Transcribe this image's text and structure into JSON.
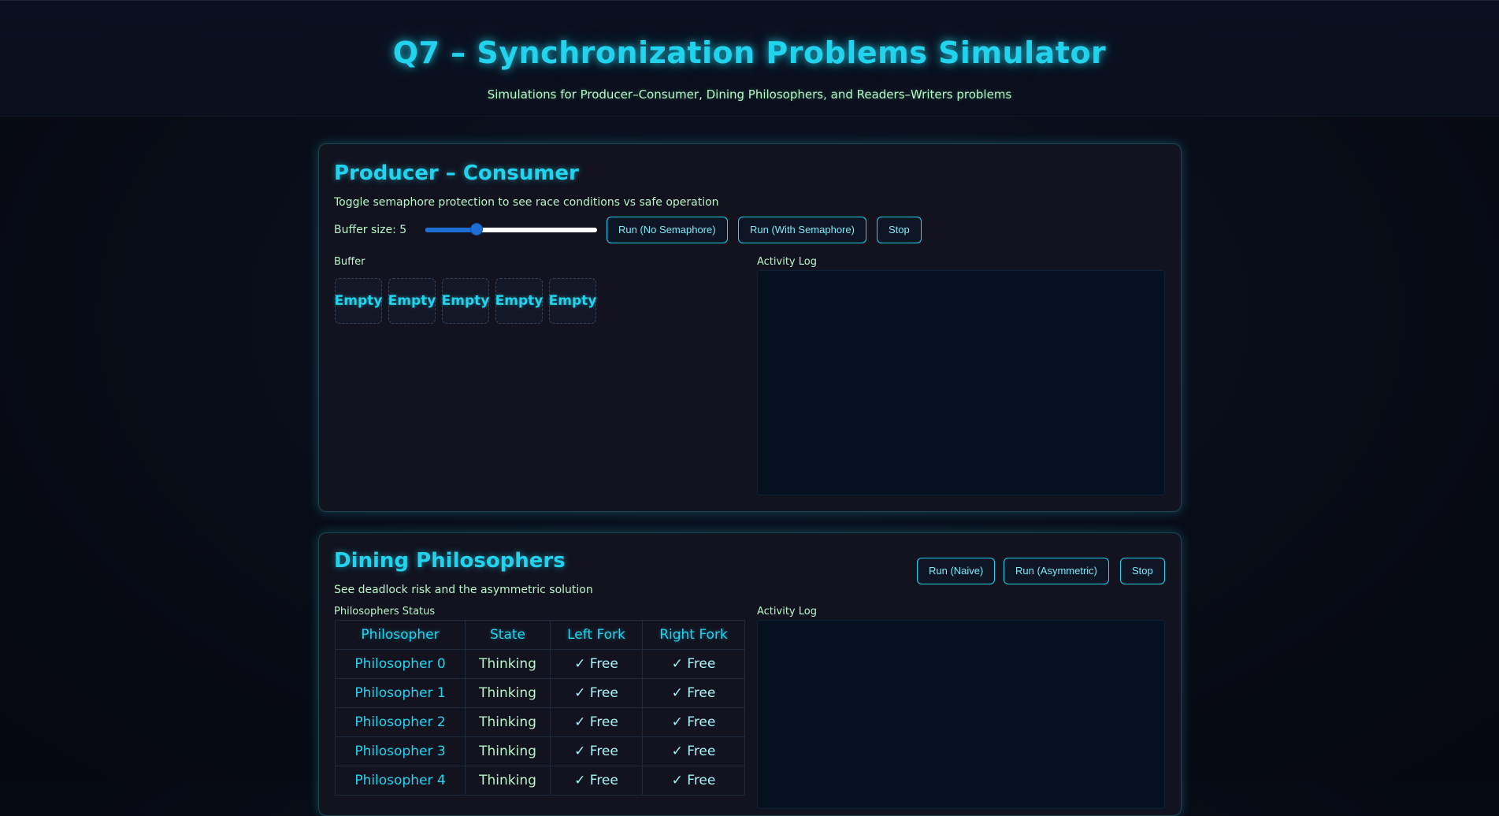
{
  "header": {
    "title": "Q7 – Synchronization Problems Simulator",
    "subtitle": "Simulations for Producer–Consumer, Dining Philosophers, and Readers–Writers problems"
  },
  "producer_consumer": {
    "title": "Producer – Consumer",
    "description": "Toggle semaphore protection to see race conditions vs safe operation",
    "buffer_size_label": "Buffer size: 5",
    "buffer_size_value": 5,
    "slider_fraction": 0.3,
    "buttons": {
      "run_no_semaphore": "Run (No Semaphore)",
      "run_with_semaphore": "Run (With Semaphore)",
      "stop": "Stop"
    },
    "buffer_label": "Buffer",
    "buffer_slots": [
      "Empty",
      "Empty",
      "Empty",
      "Empty",
      "Empty"
    ],
    "log_label": "Activity Log"
  },
  "dining_philosophers": {
    "title": "Dining Philosophers",
    "description": "See deadlock risk and the asymmetric solution",
    "buttons": {
      "run_naive": "Run (Naive)",
      "run_asymmetric": "Run (Asymmetric)",
      "stop": "Stop"
    },
    "status_label": "Philosophers Status",
    "log_label": "Activity Log",
    "columns": [
      "Philosopher",
      "State",
      "Left Fork",
      "Right Fork"
    ],
    "rows": [
      {
        "name": "Philosopher 0",
        "state": "Thinking",
        "left": "✓ Free",
        "right": "✓ Free"
      },
      {
        "name": "Philosopher 1",
        "state": "Thinking",
        "left": "✓ Free",
        "right": "✓ Free"
      },
      {
        "name": "Philosopher 2",
        "state": "Thinking",
        "left": "✓ Free",
        "right": "✓ Free"
      },
      {
        "name": "Philosopher 3",
        "state": "Thinking",
        "left": "✓ Free",
        "right": "✓ Free"
      },
      {
        "name": "Philosopher 4",
        "state": "Thinking",
        "left": "✓ Free",
        "right": "✓ Free"
      }
    ]
  },
  "colors": {
    "accent": "#22d3ee",
    "text_green": "#b8f5c8",
    "panel_bg": "#12131f",
    "log_bg": "#051020",
    "slider_fill": "#1d6fd6"
  }
}
